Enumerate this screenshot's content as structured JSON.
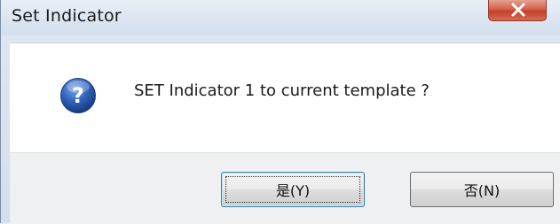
{
  "window": {
    "title": "Set Indicator",
    "close_icon": "close-icon"
  },
  "message": {
    "icon": "question-icon",
    "icon_color": "#2f62b8",
    "text": "SET Indicator 1 to current template ?"
  },
  "buttons": {
    "yes_label": "是(Y)",
    "no_label": "否(N)",
    "default": "yes"
  },
  "colors": {
    "close_button": "#c5402a",
    "default_button_border": "#3c7fb1"
  }
}
